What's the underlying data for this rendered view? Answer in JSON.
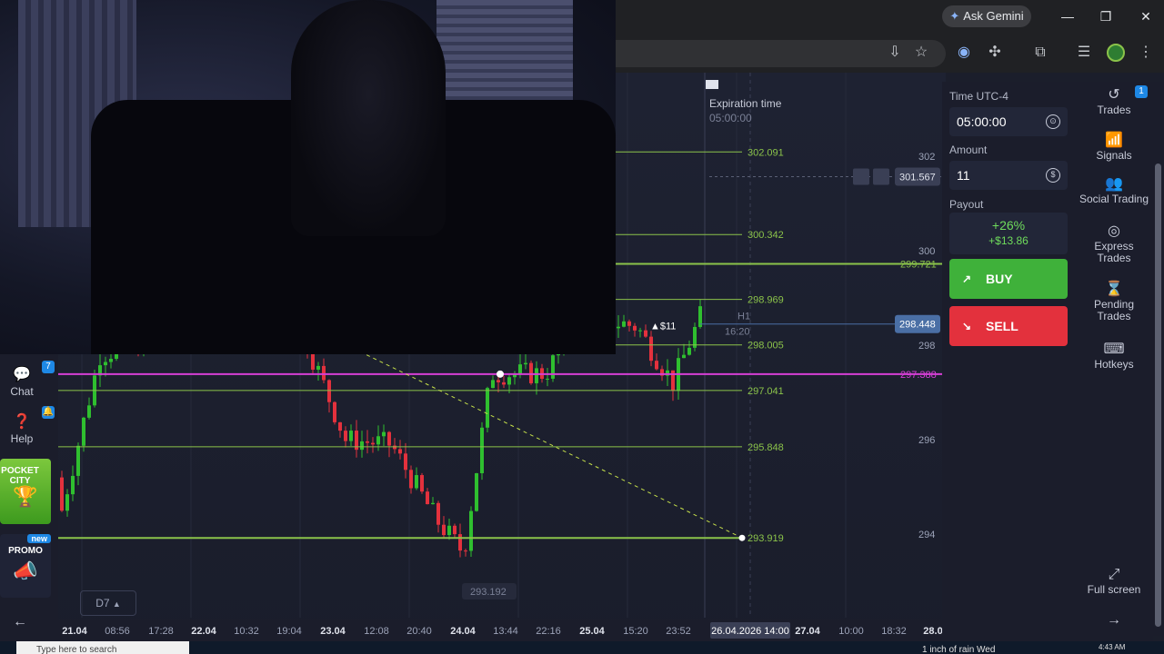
{
  "browser": {
    "ask_gemini": "Ask Gemini",
    "minimize": "—",
    "restore": "❐",
    "close": "✕"
  },
  "chart_data": {
    "type": "candlestick",
    "timeframe": "H1",
    "price_axis_ticks": [
      "302",
      "300",
      "298",
      "296",
      "294"
    ],
    "time_axis_ticks": [
      "21.04",
      "08:56",
      "17:28",
      "22.04",
      "10:32",
      "19:04",
      "23.04",
      "12:08",
      "20:40",
      "24.04",
      "13:44",
      "22:16",
      "25.04",
      "15:20",
      "23:52",
      "27.04",
      "10:00",
      "18:32",
      "28.0"
    ],
    "time_axis_highlight": "26.04.2026 14:00",
    "levels": [
      {
        "value": 302.091,
        "label": "302.091",
        "color": "#8bc34a"
      },
      {
        "value": 300.342,
        "label": "300.342",
        "color": "#8bc34a"
      },
      {
        "value": 299.721,
        "label": "299.721",
        "color": "#8bc34a"
      },
      {
        "value": 298.969,
        "label": "298.969",
        "color": "#8bc34a"
      },
      {
        "value": 298.005,
        "label": "298.005",
        "color": "#8bc34a"
      },
      {
        "value": 297.388,
        "label": "297.388",
        "color": "#d63fd6"
      },
      {
        "value": 297.041,
        "label": "297.041",
        "color": "#8bc34a"
      },
      {
        "value": 295.848,
        "label": "295.848",
        "color": "#8bc34a"
      },
      {
        "value": 293.919,
        "label": "293.919",
        "color": "#8bc34a"
      }
    ],
    "current_price": "298.448",
    "crosshair_price": "301.567",
    "low_label": "293.192",
    "trade_marker": "$11",
    "trade_time": "16:20",
    "expiration_label": "Expiration time",
    "expiration_value": "05:00:00",
    "up_color": "#2fbf2f",
    "down_color": "#e3313d"
  },
  "left_sidebar": {
    "chat": "Chat",
    "chat_badge": "7",
    "help": "Help",
    "pocket_city": "POCKET CITY",
    "promo": "PROMO",
    "promo_badge": "new",
    "timeframe_button": "D7"
  },
  "trade_panel": {
    "time_label": "Time UTC-4",
    "time_value": "05:00:00",
    "amount_label": "Amount",
    "amount_value": "11",
    "payout_label": "Payout",
    "payout_percent": "+26%",
    "payout_amount": "+$13.86",
    "buy": "BUY",
    "sell": "SELL"
  },
  "right_nav": {
    "trades": "Trades",
    "trades_badge": "1",
    "signals": "Signals",
    "social": "Social Trading",
    "express": "Express Trades",
    "pending": "Pending Trades",
    "hotkeys": "Hotkeys",
    "fullscreen": "Full screen"
  },
  "taskbar": {
    "search_placeholder": "Type here to search",
    "weather": "1 inch of rain Wed",
    "clock_time": "4:43 AM"
  }
}
